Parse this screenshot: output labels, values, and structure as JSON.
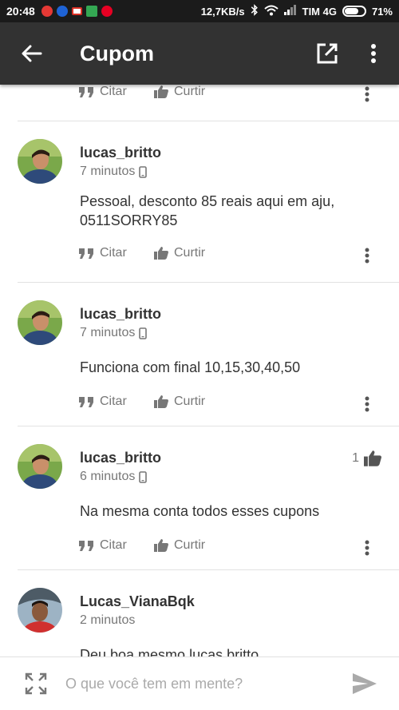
{
  "status_bar": {
    "time": "20:48",
    "net_speed": "12,7KB/s",
    "carrier": "TIM 4G",
    "battery": "71%"
  },
  "header": {
    "title": "Cupom"
  },
  "actions": {
    "cite": "Citar",
    "like": "Curtir"
  },
  "posts": [
    {
      "author": "lucas_britto",
      "time": "7 minutos",
      "text": "Pessoal, desconto 85 reais aqui em aju, 0511SORRY85",
      "likes": ""
    },
    {
      "author": "lucas_britto",
      "time": "7 minutos",
      "text": "Funciona com final 10,15,30,40,50",
      "likes": ""
    },
    {
      "author": "lucas_britto",
      "time": "6 minutos",
      "text": "Na mesma conta todos esses cupons",
      "likes": "1"
    },
    {
      "author": "Lucas_VianaBqk",
      "time": "2 minutos",
      "text": "Deu boa mesmo lucas britto",
      "likes": ""
    }
  ],
  "composer": {
    "placeholder": "O que você tem em mente?"
  },
  "colors": {
    "appbar": "#323232",
    "statusbar": "#1b1b1b",
    "text": "#333333",
    "muted": "#777777",
    "divider": "#e2e2e2"
  }
}
